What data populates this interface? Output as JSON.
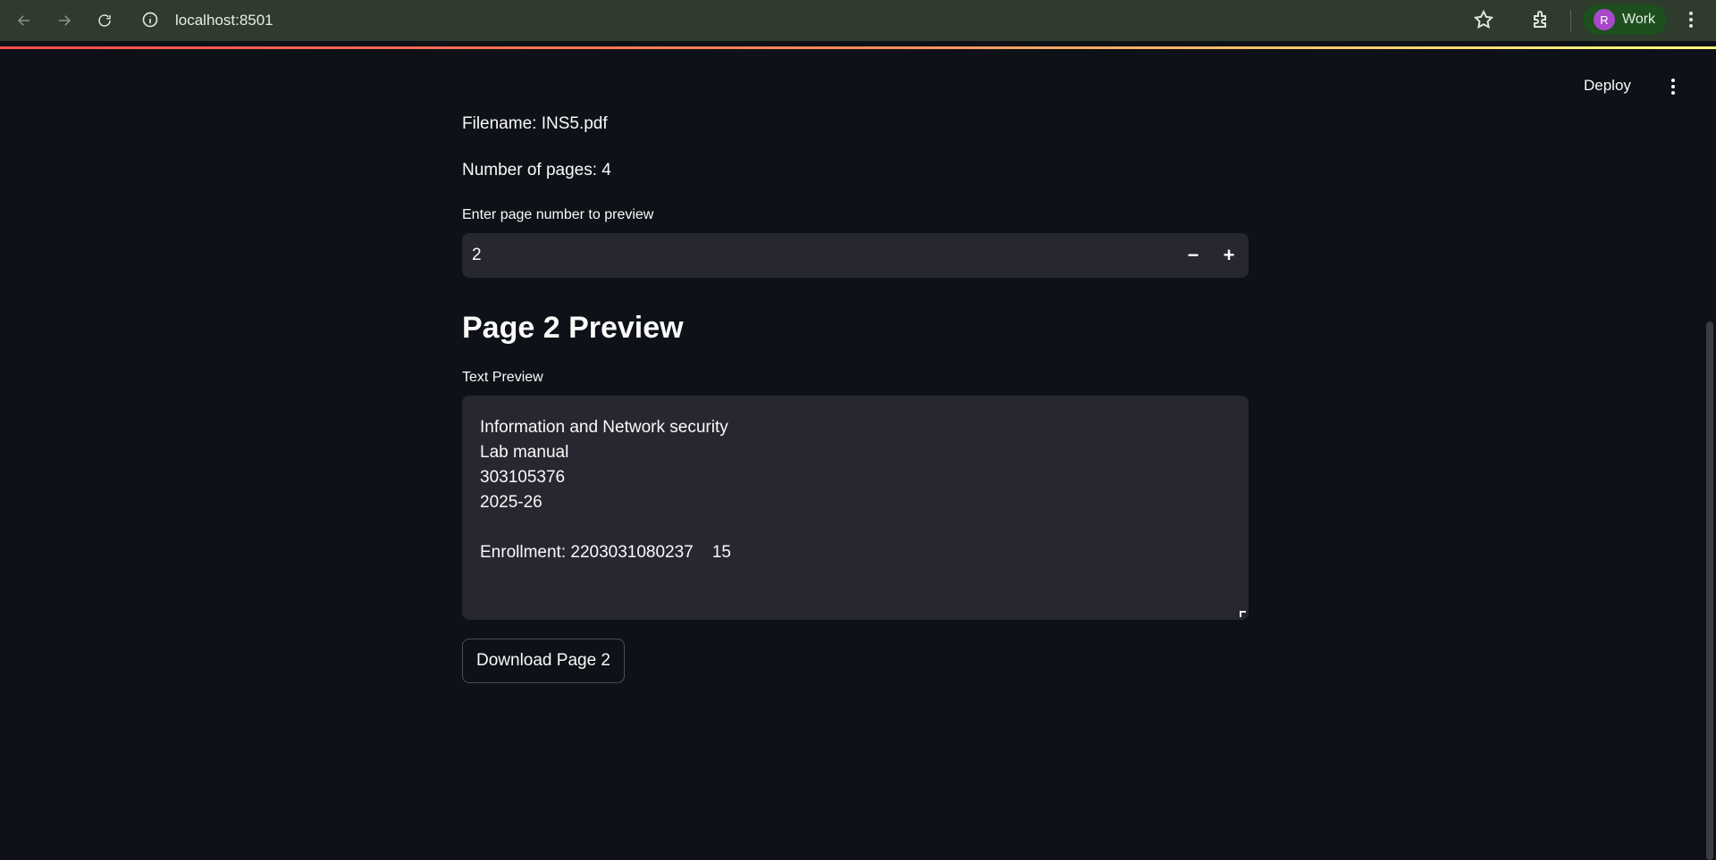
{
  "browser": {
    "url": "localhost:8501",
    "profile_initial": "R",
    "profile_label": "Work"
  },
  "header": {
    "deploy_label": "Deploy"
  },
  "main": {
    "filename_text": "Filename: INS5.pdf",
    "pages_text": "Number of pages: 4",
    "page_input_label": "Enter page number to preview",
    "page_input_value": "2",
    "decrement_symbol": "−",
    "increment_symbol": "+",
    "preview_heading": "Page 2 Preview",
    "text_preview_label": "Text Preview",
    "text_preview_lines": [
      "Information and Network security",
      "Lab manual",
      "303105376",
      "2025-26",
      "",
      "Enrollment: 2203031080237    15"
    ],
    "download_button_label": "Download Page 2"
  },
  "colors": {
    "app_background": "#0e1117",
    "widget_background": "#262730",
    "browser_bar": "#2f3b2c",
    "accent_gradient": [
      "#ff4b4b",
      "#fffd80"
    ]
  }
}
